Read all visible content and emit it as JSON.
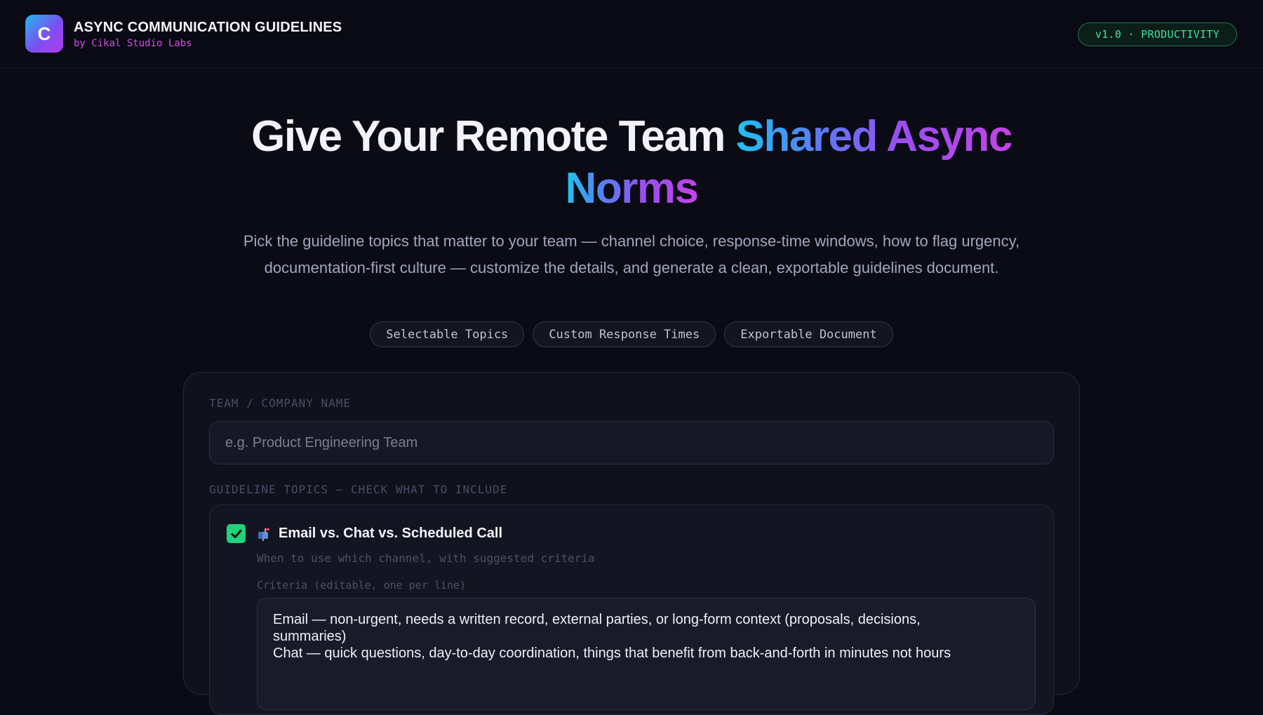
{
  "header": {
    "logo_letter": "C",
    "title": "ASYNC COMMUNICATION GUIDELINES",
    "subtitle": "by Cikal Studio Labs",
    "version_badge": "v1.0 · PRODUCTIVITY"
  },
  "hero": {
    "title_plain": "Give Your Remote Team ",
    "title_gradient_1": "Shared Async",
    "title_gradient_2": "Norms",
    "description": "Pick the guideline topics that matter to your team — channel choice, response-time windows, how to flag urgency, documentation-first culture — customize the details, and generate a clean, exportable guidelines document.",
    "pills": [
      "Selectable Topics",
      "Custom Response Times",
      "Exportable Document"
    ]
  },
  "form": {
    "team_label": "TEAM / COMPANY NAME",
    "team_placeholder": "e.g. Product Engineering Team",
    "topics_label": "GUIDELINE TOPICS — CHECK WHAT TO INCLUDE",
    "topics": [
      {
        "checked": true,
        "icon": "mailbox-icon",
        "title": "Email vs. Chat vs. Scheduled Call",
        "description": "When to use which channel, with suggested criteria",
        "criteria_label": "Criteria (editable, one per line)",
        "criteria_lines": [
          "Email — non-urgent, needs a written record, external parties, or long-form context (proposals, decisions,",
          "summaries)",
          "Chat — quick questions, day-to-day coordination, things that benefit from back-and-forth in minutes not hours"
        ]
      }
    ]
  },
  "colors": {
    "background": "#0b0b16",
    "accent_green": "#20d37a",
    "accent_pink": "#d24fe3",
    "gradient_start": "#1fc2f2",
    "gradient_end": "#c444e8"
  }
}
